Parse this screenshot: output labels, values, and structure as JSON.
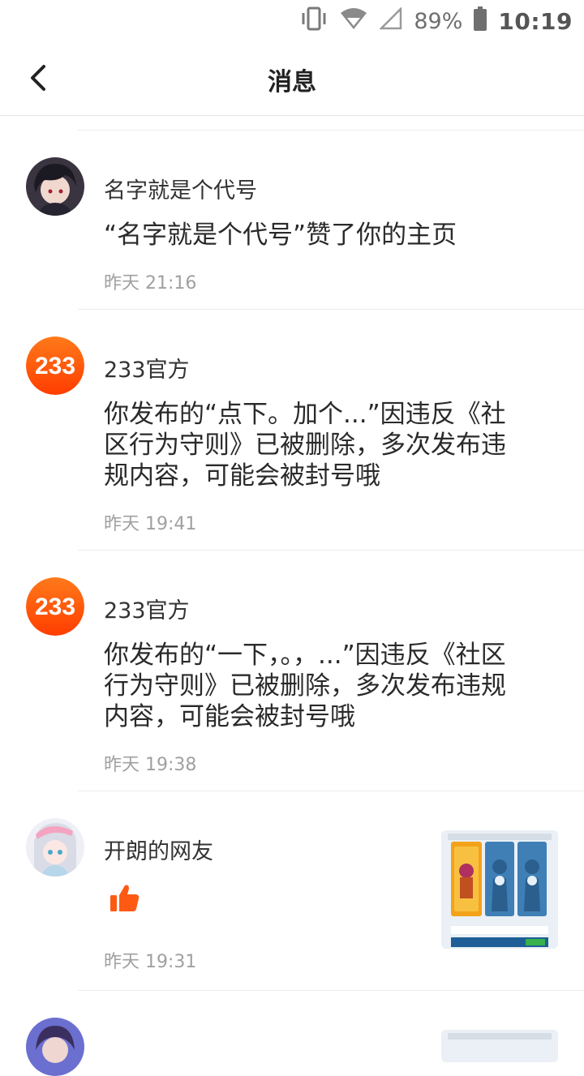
{
  "status_bar": {
    "battery_percent": "89%",
    "time": "10:19"
  },
  "header": {
    "title": "消息"
  },
  "messages": [
    {
      "name": "名字就是个代号",
      "text": "“名字就是个代号”赞了你的主页",
      "time": "昨天 21:16"
    },
    {
      "name": "233官方",
      "avatar_label": "233",
      "text": "你发布的“点下。加个...”因违反《社区行为守则》已被删除，多次发布违规内容，可能会被封号哦",
      "time": "昨天 19:41"
    },
    {
      "name": "233官方",
      "avatar_label": "233",
      "text": "你发布的“一下，。，...”因违反《社区行为守则》已被删除，多次发布违规内容，可能会被封号哦",
      "time": "昨天 19:38"
    },
    {
      "name": "开朗的网友",
      "icon": "thumbs-up-icon",
      "time": "昨天 19:31"
    }
  ],
  "colors": {
    "brand_orange": "#ff5a0a",
    "like_orange": "#ff5a14"
  }
}
